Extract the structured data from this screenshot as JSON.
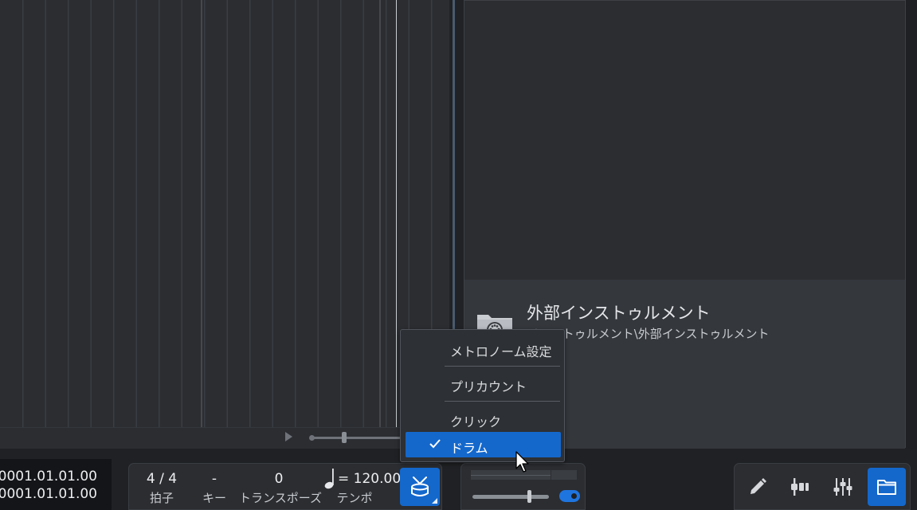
{
  "browser": {
    "instrument_title": "外部インストゥルメント",
    "instrument_path": "インストゥルメント\\外部インストゥルメント"
  },
  "transport": {
    "time_primary": "0001.01.01.00",
    "time_secondary": "0001.01.01.00",
    "time_signature": {
      "value": "4 / 4",
      "label": "拍子"
    },
    "key": {
      "value": "-",
      "label": "キー"
    },
    "transpose": {
      "value": "0",
      "label": "トランスポーズ"
    },
    "tempo": {
      "value": "= 120.00",
      "label": "テンポ"
    }
  },
  "metronome_menu": {
    "items": [
      {
        "label": "メトロノーム設定",
        "checked": false
      },
      {
        "label": "プリカウント",
        "checked": false
      },
      {
        "label": "クリック",
        "checked": false
      },
      {
        "label": "ドラム",
        "checked": true
      }
    ]
  },
  "colors": {
    "accent": "#1468cc",
    "panel": "#2b2d31",
    "background": "#1f2124"
  },
  "icons": {
    "metronome_button": "drum-icon",
    "tools": [
      "pencil-icon",
      "fader-icon",
      "mixer-icon",
      "folder-icon"
    ]
  }
}
